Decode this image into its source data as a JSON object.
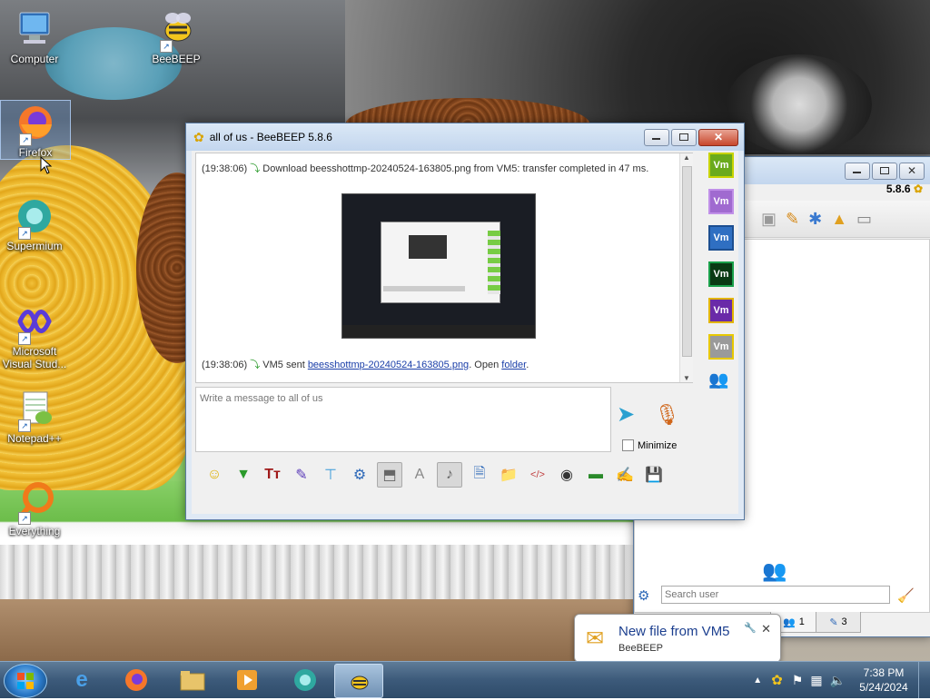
{
  "desktop_icons": [
    {
      "label": "Computer",
      "icon": "computer-icon"
    },
    {
      "label": "BeeBEEP",
      "icon": "beebeep-icon"
    },
    {
      "label": "Firefox",
      "icon": "firefox-icon"
    },
    {
      "label": "Supermium",
      "icon": "supermium-icon"
    },
    {
      "label": "Microsoft Visual Stud...",
      "icon": "visual-studio-icon"
    },
    {
      "label": "Notepad++",
      "icon": "notepadpp-icon"
    },
    {
      "label": "Everything",
      "icon": "everything-icon"
    }
  ],
  "chat_window": {
    "title": "all of us - BeeBEEP 5.8.6",
    "messages": [
      {
        "time": "(19:38:06)",
        "text": "Download beesshottmp-20240524-163805.png from VM5: transfer completed in 47 ms."
      },
      {
        "time": "(19:38:06)",
        "prefix": "VM5 sent ",
        "link": "beesshottmp-20240524-163805.png",
        "middle": ". Open ",
        "folder_link": "folder",
        "suffix": "."
      }
    ],
    "user_badges": [
      {
        "label": "Vm",
        "color": "#6aaa1c",
        "border": "#c8d400"
      },
      {
        "label": "Vm",
        "color": "#a06ad0",
        "border": "#c08fe8"
      },
      {
        "label": "Vm",
        "color": "#2f6fc2",
        "border": "#1c4e90"
      },
      {
        "label": "Vm",
        "color": "#0a3a14",
        "border": "#1aa04a"
      },
      {
        "label": "Vm",
        "color": "#6a2aa8",
        "border": "#e2b400"
      },
      {
        "label": "Vm",
        "color": "#9a9a9a",
        "border": "#e8c800"
      }
    ],
    "input_placeholder": "Write a message to all of us",
    "minimize_label": "Minimize"
  },
  "main_window": {
    "version": "5.8.6",
    "search_placeholder": "Search user",
    "tab1_count": "1",
    "tab2_count": "3"
  },
  "notification": {
    "title": "New file from VM5",
    "subtitle": "BeeBEEP"
  },
  "taskbar": {
    "time": "7:38 PM",
    "date": "5/24/2024"
  }
}
